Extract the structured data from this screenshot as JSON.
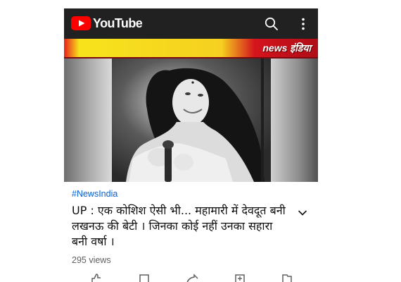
{
  "header": {
    "app_name": "YouTube",
    "logo_icon": "youtube-play-icon",
    "search_icon": "search-icon",
    "menu_icon": "more-vertical-icon",
    "background": "#212121",
    "logo_red": "#ff0000"
  },
  "video": {
    "channel_watermark": "news इंडिया",
    "accent_yellow": "#f5d020",
    "accent_red": "#c8102e"
  },
  "details": {
    "hashtag": "#NewsIndia",
    "title": "UP : एक कोशिश ऐसी भी... महामारी में देवदूत बनी लखनऊ की बेटी । जिनका कोई नहीं उनका सहारा बनी वर्षा ।",
    "expand_icon": "chevron-down-icon",
    "views": "295 views",
    "hashtag_color": "#065fd4"
  },
  "actions": {
    "icons": [
      "like-icon",
      "dislike-icon",
      "share-icon",
      "save-to-playlist-icon",
      "save-icon"
    ]
  }
}
